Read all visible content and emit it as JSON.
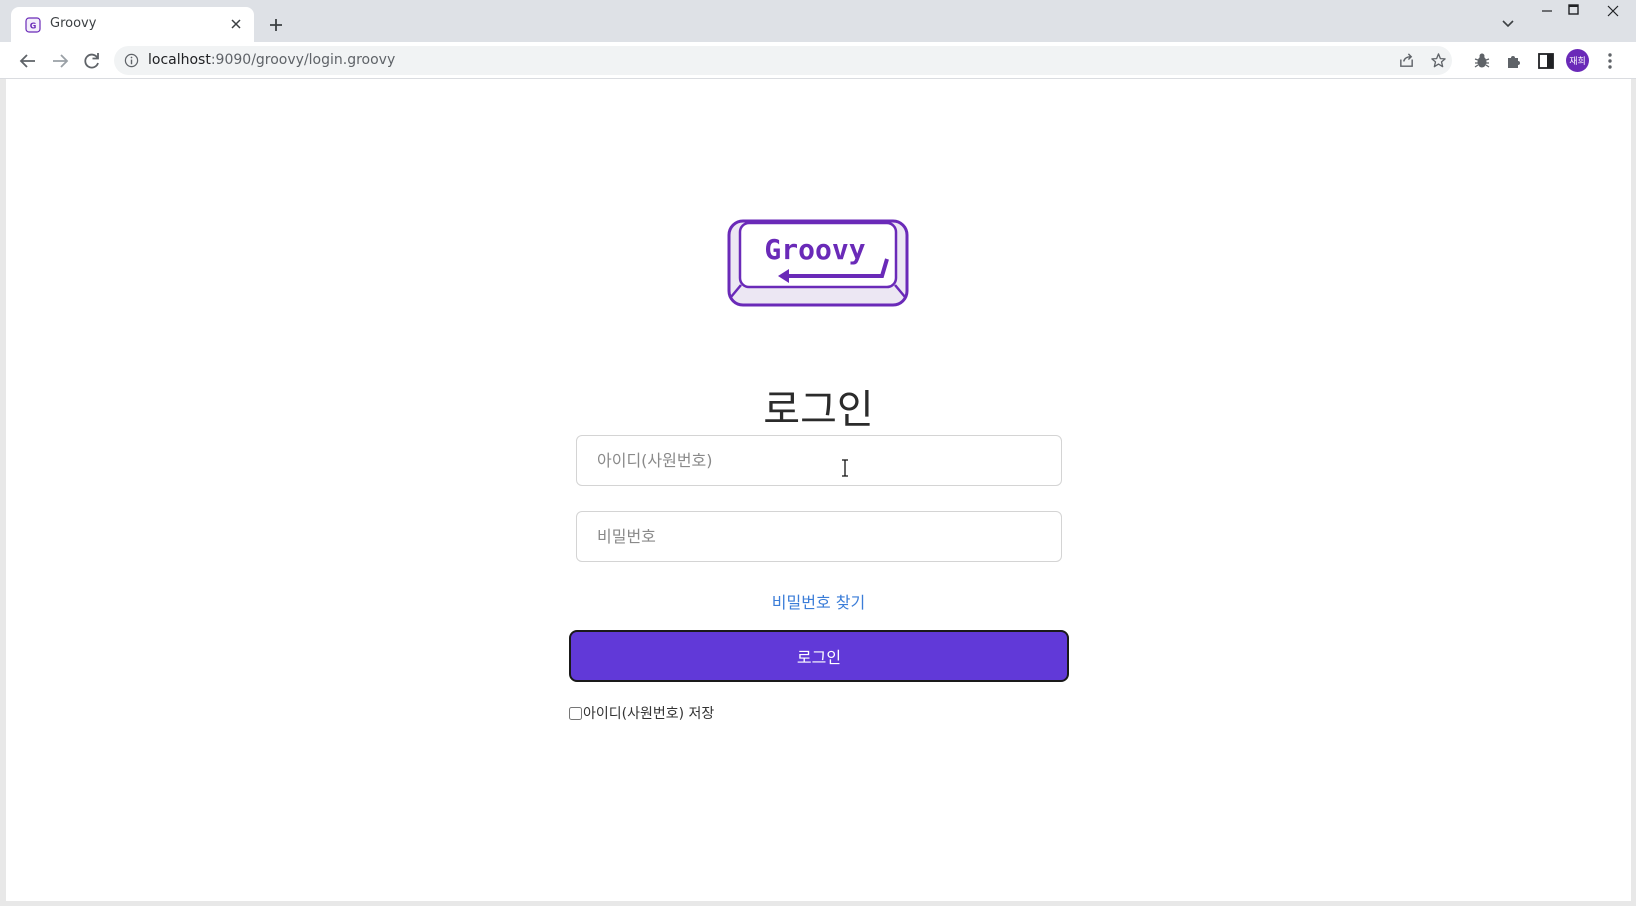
{
  "browser": {
    "tab_title": "Groovy",
    "url_host": "localhost",
    "url_rest": ":9090/groovy/login.groovy",
    "avatar_text": "재희"
  },
  "page": {
    "logo_text": "Groovy",
    "title": "로그인",
    "id_placeholder": "아이디(사원번호)",
    "pw_placeholder": "비밀번호",
    "find_password": "비밀번호 찾기",
    "login_button": "로그인",
    "remember_id": "아이디(사원번호) 저장"
  },
  "colors": {
    "accent": "#6139d8",
    "link": "#3b7dd8",
    "logo_purple": "#6a2ab8"
  }
}
